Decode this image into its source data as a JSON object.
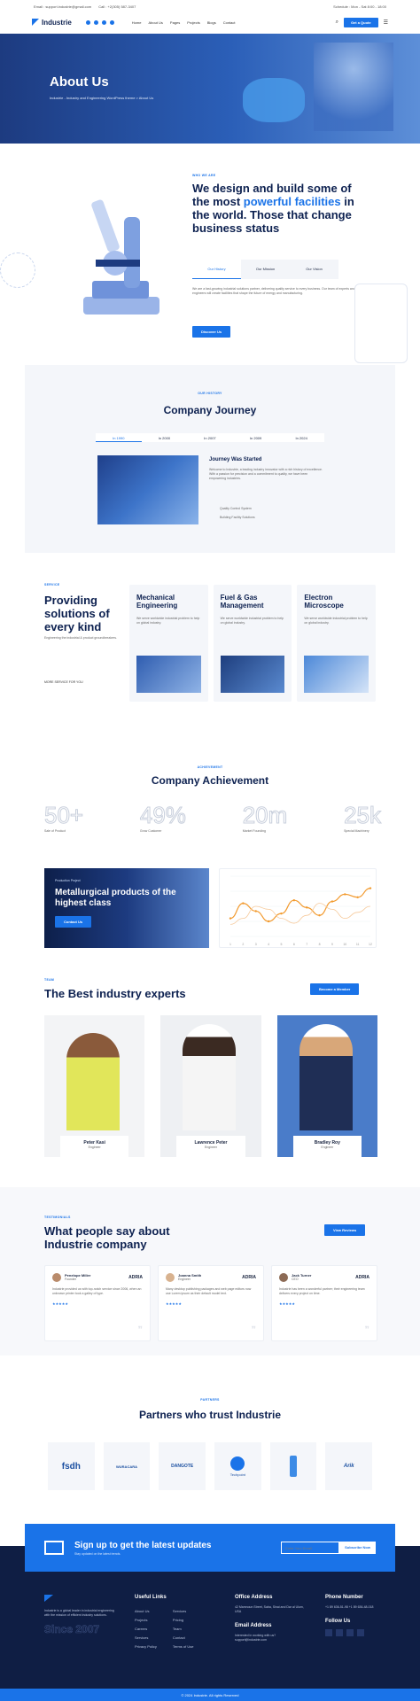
{
  "topbar": {
    "email": "Email : support.industrie@gmail.com",
    "call": "Call : +2(305) 587-3407",
    "right": "Schedule : Mon - Sat 8:00 - 18:00"
  },
  "nav": {
    "brand": "Industrie",
    "menu": [
      "Home",
      "About Us",
      "Pages",
      "Projects",
      "Blogs",
      "Contact"
    ],
    "cta": "Get a Quote"
  },
  "hero": {
    "title": "About Us",
    "subtitle": "Industrie - Industry and Engineering WordPress theme  >  About Us"
  },
  "about": {
    "tag": "WHO WE ARE",
    "title_1": "We design and build some of the most ",
    "title_hl": "powerful facilities",
    "title_2": " in the world. Those that change business status",
    "tabs": [
      "Our History",
      "Our Mission",
      "Our Vision"
    ],
    "text": "We are a fast-growing industrial solutions partner, delivering quality service to every business. Our team of experts and engineers will create facilities that shape the future of energy and manufacturing.",
    "cta": "Discover Us"
  },
  "journey": {
    "tag": "OUR HISTORY",
    "title": "Company Journey",
    "years": [
      "In 1990",
      "In 2000",
      "In 2007",
      "In 2009",
      "In 2024"
    ],
    "heading": "Journey Was Started",
    "text": "Welcome to Industrie, a leading industry innovator with a rich history of excellence. With a passion for precision and a commitment to quality, we have been empowering industries.",
    "items": [
      "Quality Control System",
      "Building Facility Solutions"
    ]
  },
  "services": {
    "tag": "SERVICE",
    "title": "Providing solutions of every kind",
    "text": "Engineering the industrial & product groundbreakers.",
    "link": "MORE SERVICE FOR YOU",
    "cards": [
      {
        "title": "Mechanical Engineering",
        "text": "We serve worldwide industrial problem to help on global industry."
      },
      {
        "title": "Fuel & Gas Management",
        "text": "We serve worldwide industrial problem to help on global industry."
      },
      {
        "title": "Electron Microscope",
        "text": "We serve worldwide industrial problem to help on global industry."
      }
    ]
  },
  "achievement": {
    "tag": "ACHIEVEMENT",
    "title": "Company Achievement",
    "stats": [
      {
        "num": "50+",
        "label": "Sale of Product"
      },
      {
        "num": "49%",
        "label": "Grow Customer"
      },
      {
        "num": "20m",
        "label": "Market Founding"
      },
      {
        "num": "25k",
        "label": "Special Machinery"
      }
    ],
    "promo_tag": "Production Project",
    "promo_title": "Metallurgical products of the highest class",
    "promo_btn": "Contact Us"
  },
  "chart_data": {
    "type": "line",
    "x": [
      "1",
      "2",
      "3",
      "4",
      "5",
      "6",
      "7",
      "8",
      "9",
      "10",
      "11",
      "12"
    ],
    "series": [
      {
        "values": [
          30,
          55,
          42,
          25,
          38,
          60,
          48,
          35,
          58,
          70,
          65,
          80
        ],
        "color": "#f29a2e"
      },
      {
        "values": [
          20,
          30,
          50,
          45,
          30,
          22,
          35,
          55,
          45,
          30,
          40,
          50
        ],
        "color": "#f6c99a"
      }
    ],
    "ylim": [
      0,
      100
    ]
  },
  "team": {
    "tag": "TEAM",
    "title": "The Best industry experts",
    "cta": "Become a Member",
    "members": [
      {
        "name": "Peter Kasi",
        "role": "Engineer"
      },
      {
        "name": "Lawrence Peter",
        "role": "Engineer"
      },
      {
        "name": "Bradley Roy",
        "role": "Engineer"
      }
    ]
  },
  "testimonials": {
    "tag": "TESTIMONIALS",
    "title": "What people say about Industrie company",
    "cta": "View Reviews",
    "items": [
      {
        "name": "Penelope Miller",
        "role": "Founder",
        "text": "Industrie provided us with top-notch service since 2006, when an unknown printer took a galley of type.",
        "brand": "ADRIA"
      },
      {
        "name": "Joanna Smith",
        "role": "Engineer",
        "text": "Many desktop publishing packages and web page editors now use Lorem ipsum as their default model text.",
        "brand": "ADRIA"
      },
      {
        "name": "Jack Turner",
        "role": "CEO",
        "text": "Industrie has been a wonderful partner; their engineering team delivers every project on time.",
        "brand": "ADRIA"
      }
    ],
    "stars": "★★★★★"
  },
  "partners": {
    "tag": "PARTNERS",
    "title": "Partners who trust Industrie",
    "logos": [
      "fsdh",
      "WURACARA",
      "DANGOTE",
      "Techpoint",
      "",
      "Arik"
    ]
  },
  "newsletter": {
    "title": "Sign up to get the latest updates",
    "sub": "Stay updated on the latest trends.",
    "placeholder": "Enter Your Email",
    "btn": "Subscribe Now"
  },
  "footer": {
    "about": "Industrie is a global leader in industrial engineering with the mission of efficient industry solutions.",
    "since": "Since 2007",
    "useful": "Useful Links",
    "links1": [
      "About Us",
      "Projects",
      "Careers",
      "Services",
      "Privacy Policy"
    ],
    "links2": [
      "Services",
      "Pricing",
      "Team",
      "Contact",
      "Terms of Use"
    ],
    "office": "Office Address",
    "address": "42 Mamnoun Street, Saba, Sinai and Dar al Ulum, USA",
    "email_h": "Email Address",
    "email": "Interested in working with us? support@industrie.com",
    "phone_h": "Phone Number",
    "phones": "+1 89 636-51-98 +1 89 636-48-018",
    "follow": "Follow Us",
    "copyright": "© 2024 Industrie. All rights Reserved"
  }
}
